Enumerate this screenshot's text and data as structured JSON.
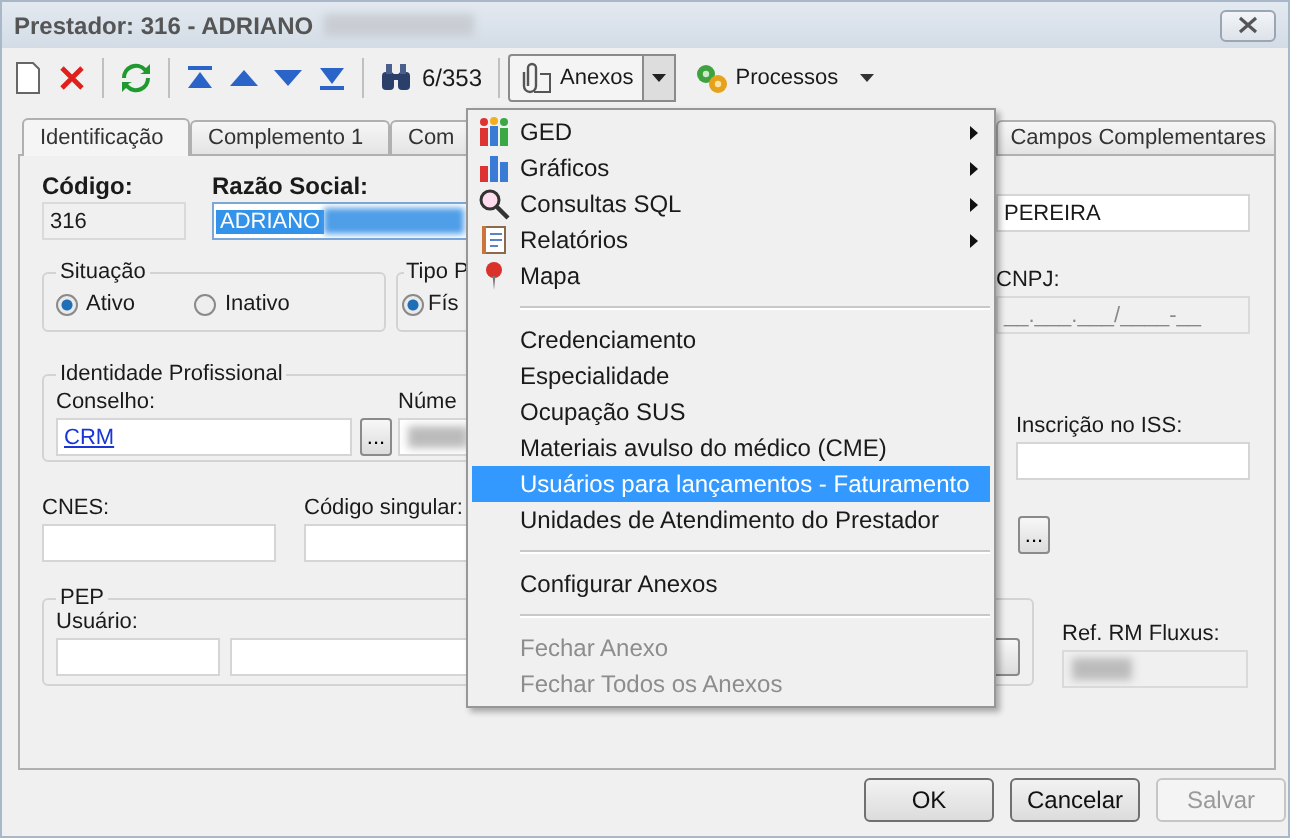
{
  "window": {
    "title": "Prestador: 316 - ADRIANO"
  },
  "toolbar": {
    "record_position": "6/353",
    "buttons": [
      {
        "label": "Anexos",
        "kind": "split"
      },
      {
        "label": "Processos",
        "kind": "dropdown"
      }
    ]
  },
  "tabs": [
    {
      "label": "Identificação",
      "selected": true
    },
    {
      "label": "Complemento 1",
      "selected": false
    },
    {
      "label": "Com",
      "selected": false
    },
    {
      "label": "Campos Complementares",
      "selected": false
    }
  ],
  "form": {
    "codigo": {
      "label": "Código:",
      "value": "316",
      "disabled": true
    },
    "razao_social": {
      "label": "Razão Social:",
      "value": "ADRIANO"
    },
    "surname_value": "PEREIRA",
    "situacao": {
      "title": "Situação",
      "options": [
        {
          "label": "Ativo",
          "selected": true
        },
        {
          "label": "Inativo",
          "selected": false
        }
      ]
    },
    "tipo": {
      "title": "Tipo P",
      "options": [
        {
          "label": "Fís",
          "selected": true
        }
      ]
    },
    "cnpj": {
      "label": "CNPJ:",
      "placeholder": "__.___.___/____-__",
      "disabled": true
    },
    "identidade": {
      "title": "Identidade Profissional",
      "conselho_label": "Conselho:",
      "conselho_value": "CRM",
      "lookup_button": "...",
      "numero_label": "Núme"
    },
    "inscricao_iss": {
      "label": "Inscrição no ISS:"
    },
    "cnes": {
      "label": "CNES:"
    },
    "codigo_singular": {
      "label": "Código singular:"
    },
    "lookup_button": "...",
    "pep": {
      "title": "PEP",
      "usuario_label": "Usuário:"
    },
    "ref_rm_fluxus": {
      "label": "Ref. RM Fluxus:",
      "disabled": true
    }
  },
  "menu": [
    {
      "kind": "submenu",
      "label": "GED",
      "selected": false,
      "disabled": false
    },
    {
      "kind": "submenu",
      "label": "Gráficos",
      "selected": false,
      "disabled": false
    },
    {
      "kind": "submenu",
      "label": "Consultas SQL",
      "selected": false,
      "disabled": false
    },
    {
      "kind": "submenu",
      "label": "Relatórios",
      "selected": false,
      "disabled": false
    },
    {
      "kind": "item",
      "label": "Mapa",
      "selected": false,
      "disabled": false
    },
    {
      "kind": "separator"
    },
    {
      "kind": "item",
      "label": "Credenciamento",
      "selected": false,
      "disabled": false
    },
    {
      "kind": "item",
      "label": "Especialidade",
      "selected": false,
      "disabled": false
    },
    {
      "kind": "item",
      "label": "Ocupação SUS",
      "selected": false,
      "disabled": false
    },
    {
      "kind": "item",
      "label": "Materiais avulso do médico (CME)",
      "selected": false,
      "disabled": false
    },
    {
      "kind": "item",
      "label": "Usuários para lançamentos - Faturamento",
      "selected": true,
      "disabled": false
    },
    {
      "kind": "item",
      "label": "Unidades de Atendimento do Prestador",
      "selected": false,
      "disabled": false
    },
    {
      "kind": "separator"
    },
    {
      "kind": "item",
      "label": "Configurar Anexos",
      "selected": false,
      "disabled": false
    },
    {
      "kind": "separator"
    },
    {
      "kind": "item",
      "label": "Fechar Anexo",
      "selected": false,
      "disabled": true
    },
    {
      "kind": "item",
      "label": "Fechar Todos os Anexos",
      "selected": false,
      "disabled": true
    }
  ],
  "buttons": [
    {
      "label": "OK",
      "disabled": false
    },
    {
      "label": "Cancelar",
      "disabled": false
    },
    {
      "label": "Salvar",
      "disabled": true
    }
  ]
}
